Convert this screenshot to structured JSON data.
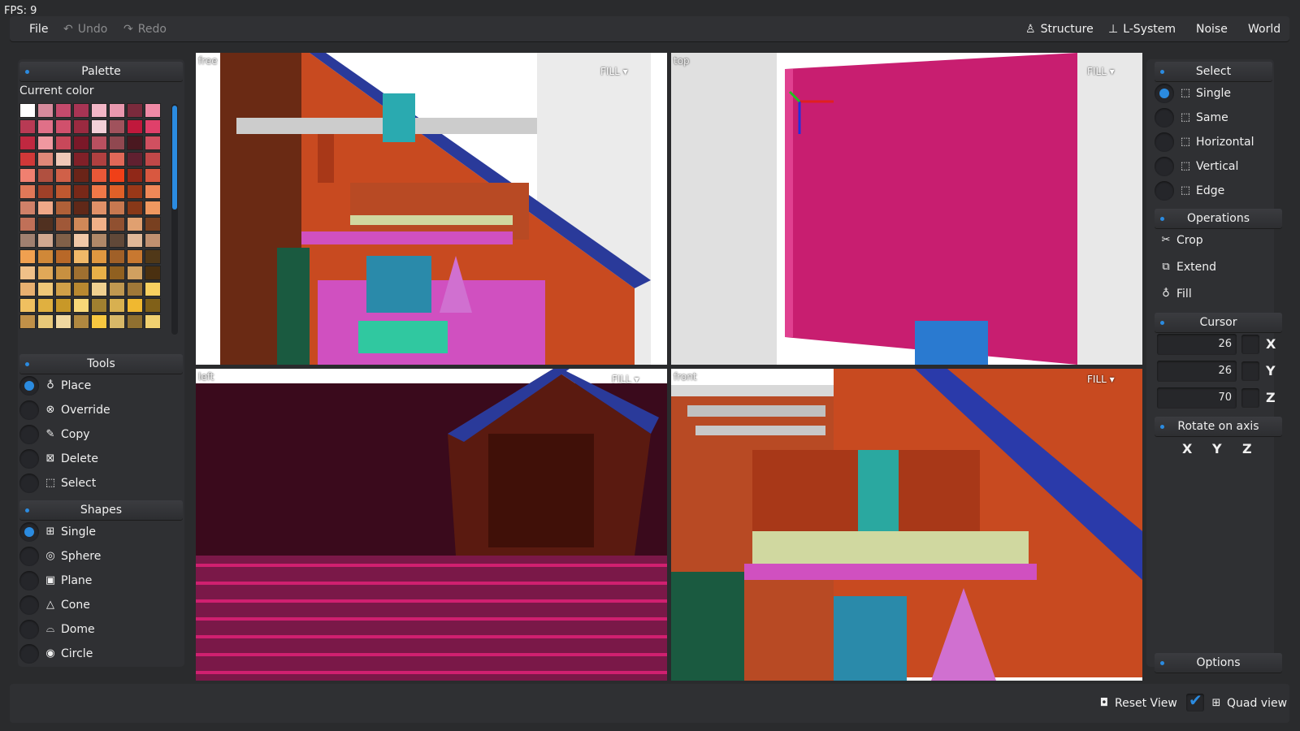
{
  "fps": "FPS: 9",
  "menu": {
    "file": "File",
    "undo": "Undo",
    "redo": "Redo",
    "structure": "Structure",
    "lsystem": "L-System",
    "noise": "Noise",
    "world": "World"
  },
  "palette": {
    "title": "Palette",
    "current_color": "Current color",
    "colors": [
      "#ffffff",
      "#d68a9c",
      "#c44a6c",
      "#a83454",
      "#f2b6c6",
      "#e898ae",
      "#7a2a3c",
      "#f08aa6",
      "#b83a54",
      "#e07088",
      "#d0506c",
      "#9a2a40",
      "#f2d0d8",
      "#a0525c",
      "#c0183c",
      "#e0406a",
      "#c02840",
      "#f098a0",
      "#c8485a",
      "#7a1828",
      "#b85060",
      "#904850",
      "#4a1820",
      "#d05060",
      "#d03838",
      "#e08878",
      "#f0c8b8",
      "#802028",
      "#b04040",
      "#e06858",
      "#602030",
      "#c04848",
      "#f08070",
      "#b05040",
      "#d06048",
      "#6a2418",
      "#e85838",
      "#f04018",
      "#902818",
      "#d85840",
      "#e07858",
      "#a04028",
      "#c05830",
      "#782818",
      "#f07848",
      "#e06028",
      "#9a3818",
      "#f08858",
      "#d08068",
      "#f0a888",
      "#b06038",
      "#602818",
      "#e09068",
      "#c87850",
      "#883818",
      "#f09860",
      "#c07058",
      "#503020",
      "#a05838",
      "#d08858",
      "#f0b088",
      "#905030",
      "#e0a070",
      "#784020",
      "#a08070",
      "#d0a890",
      "#806048",
      "#f0c8a8",
      "#b08868",
      "#604838",
      "#e0b898",
      "#c09070",
      "#f0a050",
      "#d08838",
      "#b86828",
      "#f0b868",
      "#e09840",
      "#a06028",
      "#c87830",
      "#503818",
      "#f0c088",
      "#e0a858",
      "#c89040",
      "#a07030",
      "#e8b048",
      "#906020",
      "#d0a060",
      "#4a3010",
      "#e8b070",
      "#f0c878",
      "#d0a048",
      "#b88830",
      "#f0d090",
      "#c09850",
      "#a07838",
      "#f8d060",
      "#f0c060",
      "#e0b040",
      "#c89828",
      "#f8d878",
      "#a08030",
      "#d8b050",
      "#f0b830",
      "#806018",
      "#c09048",
      "#e8c878",
      "#f0d8a0",
      "#b08840",
      "#f8c840",
      "#d8b868",
      "#907030",
      "#f0d070"
    ]
  },
  "tools": {
    "title": "Tools",
    "items": [
      "Place",
      "Override",
      "Copy",
      "Delete",
      "Select"
    ]
  },
  "shapes": {
    "title": "Shapes",
    "items": [
      "Single",
      "Sphere",
      "Plane",
      "Cone",
      "Dome",
      "Circle"
    ]
  },
  "viewports": {
    "free_label": "free",
    "top_label": "top",
    "left_label": "left",
    "front_label": "front",
    "fill": "FILL"
  },
  "select": {
    "title": "Select",
    "items": [
      "Single",
      "Same",
      "Horizontal",
      "Vertical",
      "Edge"
    ]
  },
  "operations": {
    "title": "Operations",
    "crop": "Crop",
    "extend": "Extend",
    "fill": "Fill"
  },
  "cursor": {
    "title": "Cursor",
    "x": "26",
    "y": "26",
    "z": "70",
    "x_label": "X",
    "y_label": "Y",
    "z_label": "Z"
  },
  "rotate": {
    "title": "Rotate on axis",
    "x": "X",
    "y": "Y",
    "z": "Z"
  },
  "options": "Options",
  "bottom": {
    "reset_view": "Reset View",
    "quad_view": "Quad view"
  }
}
